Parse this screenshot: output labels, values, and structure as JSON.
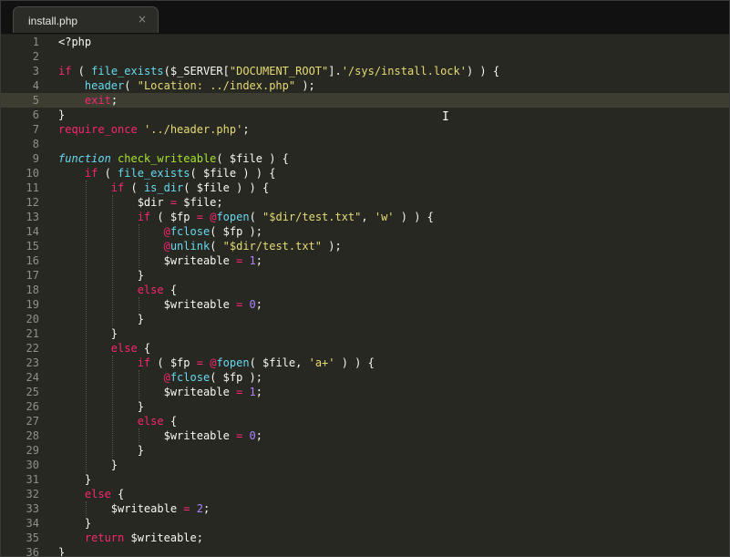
{
  "tab": {
    "title": "install.php",
    "close_glyph": "×"
  },
  "editor": {
    "current_line": 5,
    "colors": {
      "background": "#272822",
      "keyword": "#f92672",
      "function": "#66d9ef",
      "definition": "#a6e22e",
      "string": "#e6db74",
      "number": "#ae81ff",
      "gutter_text": "#8f908a",
      "current_line": "#3e3d32"
    },
    "lines": [
      {
        "n": "1",
        "tokens": [
          {
            "t": "<?php",
            "c": "plain"
          }
        ]
      },
      {
        "n": "2",
        "tokens": []
      },
      {
        "n": "3",
        "tokens": [
          {
            "t": "if",
            "c": "kw"
          },
          {
            "t": " ( ",
            "c": "plain"
          },
          {
            "t": "file_exists",
            "c": "fn"
          },
          {
            "t": "($_SERVER[",
            "c": "plain"
          },
          {
            "t": "\"DOCUMENT_ROOT\"",
            "c": "str"
          },
          {
            "t": "].",
            "c": "plain"
          },
          {
            "t": "'/sys/install.lock'",
            "c": "str"
          },
          {
            "t": ") ) {",
            "c": "plain"
          }
        ]
      },
      {
        "n": "4",
        "tokens": [
          {
            "t": "    ",
            "c": "plain"
          },
          {
            "t": "header",
            "c": "fn"
          },
          {
            "t": "( ",
            "c": "plain"
          },
          {
            "t": "\"Location: ../index.php\"",
            "c": "str"
          },
          {
            "t": " );",
            "c": "plain"
          }
        ]
      },
      {
        "n": "5",
        "tokens": [
          {
            "t": "    ",
            "c": "plain"
          },
          {
            "t": "exit",
            "c": "kw"
          },
          {
            "t": ";",
            "c": "plain"
          }
        ]
      },
      {
        "n": "6",
        "tokens": [
          {
            "t": "}",
            "c": "plain"
          }
        ]
      },
      {
        "n": "7",
        "tokens": [
          {
            "t": "require_once",
            "c": "kw"
          },
          {
            "t": " ",
            "c": "plain"
          },
          {
            "t": "'../header.php'",
            "c": "str"
          },
          {
            "t": ";",
            "c": "plain"
          }
        ]
      },
      {
        "n": "8",
        "tokens": []
      },
      {
        "n": "9",
        "tokens": [
          {
            "t": "function",
            "c": "st"
          },
          {
            "t": " ",
            "c": "plain"
          },
          {
            "t": "check_writeable",
            "c": "def"
          },
          {
            "t": "( $file ) {",
            "c": "plain"
          }
        ]
      },
      {
        "n": "10",
        "tokens": [
          {
            "t": "    ",
            "c": "plain"
          },
          {
            "t": "if",
            "c": "kw"
          },
          {
            "t": " ( ",
            "c": "plain"
          },
          {
            "t": "file_exists",
            "c": "fn"
          },
          {
            "t": "( $file ) ) {",
            "c": "plain"
          }
        ]
      },
      {
        "n": "11",
        "tokens": [
          {
            "t": "        ",
            "c": "plain"
          },
          {
            "t": "if",
            "c": "kw"
          },
          {
            "t": " ( ",
            "c": "plain"
          },
          {
            "t": "is_dir",
            "c": "fn"
          },
          {
            "t": "( $file ) ) {",
            "c": "plain"
          }
        ]
      },
      {
        "n": "12",
        "tokens": [
          {
            "t": "            $dir ",
            "c": "plain"
          },
          {
            "t": "=",
            "c": "op"
          },
          {
            "t": " $file;",
            "c": "plain"
          }
        ]
      },
      {
        "n": "13",
        "tokens": [
          {
            "t": "            ",
            "c": "plain"
          },
          {
            "t": "if",
            "c": "kw"
          },
          {
            "t": " ( $fp ",
            "c": "plain"
          },
          {
            "t": "=",
            "c": "op"
          },
          {
            "t": " ",
            "c": "plain"
          },
          {
            "t": "@",
            "c": "at"
          },
          {
            "t": "fopen",
            "c": "fn"
          },
          {
            "t": "( ",
            "c": "plain"
          },
          {
            "t": "\"$dir/test.txt\"",
            "c": "str"
          },
          {
            "t": ", ",
            "c": "plain"
          },
          {
            "t": "'w'",
            "c": "str"
          },
          {
            "t": " ) ) {",
            "c": "plain"
          }
        ]
      },
      {
        "n": "14",
        "tokens": [
          {
            "t": "                ",
            "c": "plain"
          },
          {
            "t": "@",
            "c": "at"
          },
          {
            "t": "fclose",
            "c": "fn"
          },
          {
            "t": "( $fp );",
            "c": "plain"
          }
        ]
      },
      {
        "n": "15",
        "tokens": [
          {
            "t": "                ",
            "c": "plain"
          },
          {
            "t": "@",
            "c": "at"
          },
          {
            "t": "unlink",
            "c": "fn"
          },
          {
            "t": "( ",
            "c": "plain"
          },
          {
            "t": "\"$dir/test.txt\"",
            "c": "str"
          },
          {
            "t": " );",
            "c": "plain"
          }
        ]
      },
      {
        "n": "16",
        "tokens": [
          {
            "t": "                $writeable ",
            "c": "plain"
          },
          {
            "t": "=",
            "c": "op"
          },
          {
            "t": " ",
            "c": "plain"
          },
          {
            "t": "1",
            "c": "num"
          },
          {
            "t": ";",
            "c": "plain"
          }
        ]
      },
      {
        "n": "17",
        "tokens": [
          {
            "t": "            }",
            "c": "plain"
          }
        ]
      },
      {
        "n": "18",
        "tokens": [
          {
            "t": "            ",
            "c": "plain"
          },
          {
            "t": "else",
            "c": "kw"
          },
          {
            "t": " {",
            "c": "plain"
          }
        ]
      },
      {
        "n": "19",
        "tokens": [
          {
            "t": "                $writeable ",
            "c": "plain"
          },
          {
            "t": "=",
            "c": "op"
          },
          {
            "t": " ",
            "c": "plain"
          },
          {
            "t": "0",
            "c": "num"
          },
          {
            "t": ";",
            "c": "plain"
          }
        ]
      },
      {
        "n": "20",
        "tokens": [
          {
            "t": "            }",
            "c": "plain"
          }
        ]
      },
      {
        "n": "21",
        "tokens": [
          {
            "t": "        }",
            "c": "plain"
          }
        ]
      },
      {
        "n": "22",
        "tokens": [
          {
            "t": "        ",
            "c": "plain"
          },
          {
            "t": "else",
            "c": "kw"
          },
          {
            "t": " {",
            "c": "plain"
          }
        ]
      },
      {
        "n": "23",
        "tokens": [
          {
            "t": "            ",
            "c": "plain"
          },
          {
            "t": "if",
            "c": "kw"
          },
          {
            "t": " ( $fp ",
            "c": "plain"
          },
          {
            "t": "=",
            "c": "op"
          },
          {
            "t": " ",
            "c": "plain"
          },
          {
            "t": "@",
            "c": "at"
          },
          {
            "t": "fopen",
            "c": "fn"
          },
          {
            "t": "( $file, ",
            "c": "plain"
          },
          {
            "t": "'a+'",
            "c": "str"
          },
          {
            "t": " ) ) {",
            "c": "plain"
          }
        ]
      },
      {
        "n": "24",
        "tokens": [
          {
            "t": "                ",
            "c": "plain"
          },
          {
            "t": "@",
            "c": "at"
          },
          {
            "t": "fclose",
            "c": "fn"
          },
          {
            "t": "( $fp );",
            "c": "plain"
          }
        ]
      },
      {
        "n": "25",
        "tokens": [
          {
            "t": "                $writeable ",
            "c": "plain"
          },
          {
            "t": "=",
            "c": "op"
          },
          {
            "t": " ",
            "c": "plain"
          },
          {
            "t": "1",
            "c": "num"
          },
          {
            "t": ";",
            "c": "plain"
          }
        ]
      },
      {
        "n": "26",
        "tokens": [
          {
            "t": "            }",
            "c": "plain"
          }
        ]
      },
      {
        "n": "27",
        "tokens": [
          {
            "t": "            ",
            "c": "plain"
          },
          {
            "t": "else",
            "c": "kw"
          },
          {
            "t": " {",
            "c": "plain"
          }
        ]
      },
      {
        "n": "28",
        "tokens": [
          {
            "t": "                $writeable ",
            "c": "plain"
          },
          {
            "t": "=",
            "c": "op"
          },
          {
            "t": " ",
            "c": "plain"
          },
          {
            "t": "0",
            "c": "num"
          },
          {
            "t": ";",
            "c": "plain"
          }
        ]
      },
      {
        "n": "29",
        "tokens": [
          {
            "t": "            }",
            "c": "plain"
          }
        ]
      },
      {
        "n": "30",
        "tokens": [
          {
            "t": "        }",
            "c": "plain"
          }
        ]
      },
      {
        "n": "31",
        "tokens": [
          {
            "t": "    }",
            "c": "plain"
          }
        ]
      },
      {
        "n": "32",
        "tokens": [
          {
            "t": "    ",
            "c": "plain"
          },
          {
            "t": "else",
            "c": "kw"
          },
          {
            "t": " {",
            "c": "plain"
          }
        ]
      },
      {
        "n": "33",
        "tokens": [
          {
            "t": "        $writeable ",
            "c": "plain"
          },
          {
            "t": "=",
            "c": "op"
          },
          {
            "t": " ",
            "c": "plain"
          },
          {
            "t": "2",
            "c": "num"
          },
          {
            "t": ";",
            "c": "plain"
          }
        ]
      },
      {
        "n": "34",
        "tokens": [
          {
            "t": "    }",
            "c": "plain"
          }
        ]
      },
      {
        "n": "35",
        "tokens": [
          {
            "t": "    ",
            "c": "plain"
          },
          {
            "t": "return",
            "c": "kw"
          },
          {
            "t": " $writeable;",
            "c": "plain"
          }
        ]
      },
      {
        "n": "36",
        "tokens": [
          {
            "t": "}",
            "c": "plain"
          }
        ]
      }
    ]
  }
}
